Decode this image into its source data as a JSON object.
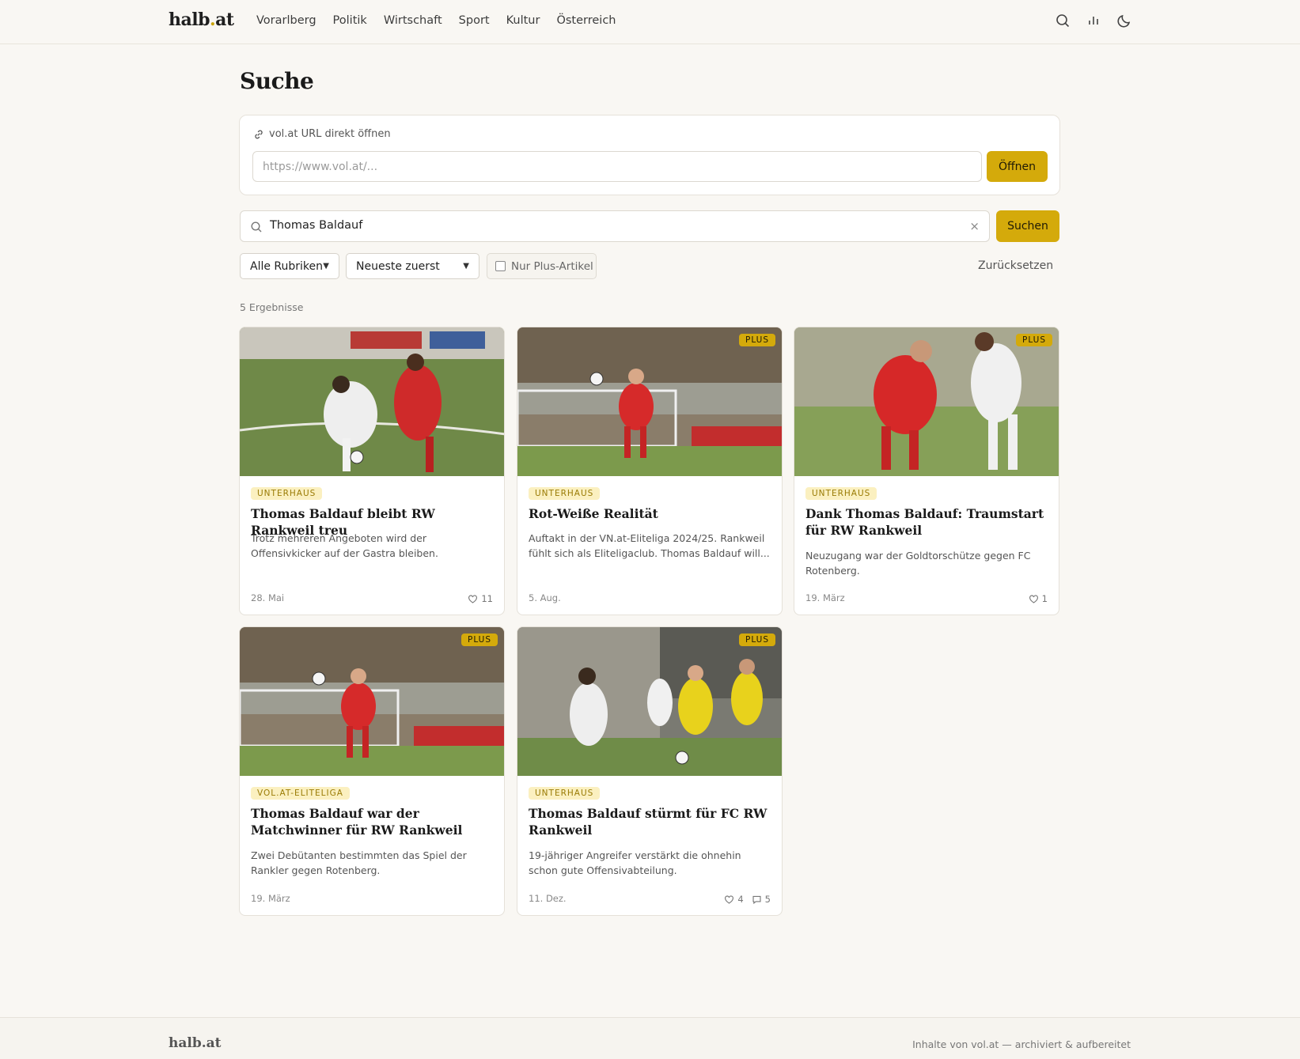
{
  "header": {
    "logo_main": "halb",
    "logo_dot": ".",
    "logo_end": "at",
    "nav": [
      "Vorarlberg",
      "Politik",
      "Wirtschaft",
      "Sport",
      "Kultur",
      "Österreich"
    ],
    "icons": [
      "search-icon",
      "chart-icon",
      "moon-icon"
    ]
  },
  "page": {
    "title": "Suche",
    "url_label": "vol.at URL direkt öffnen",
    "url_placeholder": "https://www.vol.at/...",
    "url_button": "Öffnen",
    "search_value": "Thomas Baldauf",
    "search_clear": "×",
    "search_button": "Suchen",
    "filter_rubrik": "Alle Rubriken",
    "filter_sort": "Neueste zuerst",
    "filter_plus": "Nur Plus-Artikel",
    "reset": "Zurücksetzen",
    "result_count": "5 Ergebnisse"
  },
  "cards": [
    {
      "tag": "UNTERHAUS",
      "plus": "",
      "title": "Thomas Baldauf bleibt RW Rankweil treu",
      "desc": "Trotz mehreren Angeboten wird der Offensivkicker auf der Gastra bleiben.",
      "date": "28. Mai",
      "likes": "11",
      "comments": ""
    },
    {
      "tag": "UNTERHAUS",
      "plus": "PLUS",
      "title": "Rot-Weiße Realität",
      "desc": "Auftakt in der VN.at-Eliteliga 2024/25. Rankweil fühlt sich als Eliteligaclub. Thomas Baldauf will...",
      "date": "5. Aug.",
      "likes": "",
      "comments": ""
    },
    {
      "tag": "UNTERHAUS",
      "plus": "PLUS",
      "title": "Dank Thomas Baldauf: Traumstart für RW Rankweil",
      "desc": "Neuzugang war der Goldtorschütze gegen FC Rotenberg.",
      "date": "19. März",
      "likes": "1",
      "comments": ""
    },
    {
      "tag": "VOL.AT-ELITELIGA",
      "plus": "PLUS",
      "title": "Thomas Baldauf war der Matchwinner für RW Rankweil",
      "desc": "Zwei Debütanten bestimmten das Spiel der Rankler gegen Rotenberg.",
      "date": "19. März",
      "likes": "",
      "comments": ""
    },
    {
      "tag": "UNTERHAUS",
      "plus": "PLUS",
      "title": "Thomas Baldauf stürmt für FC RW Rankweil",
      "desc": "19-jähriger Angreifer verstärkt die ohnehin schon gute Offensivabteilung.",
      "date": "11. Dez.",
      "likes": "4",
      "comments": "5"
    }
  ],
  "footer": {
    "logo": "halb.at",
    "text": "Inhalte von vol.at — archiviert & aufbereitet"
  },
  "colors": {
    "accent": "#d4aa0b",
    "background": "#f9f7f3",
    "tag_bg": "#fbf0c0"
  }
}
